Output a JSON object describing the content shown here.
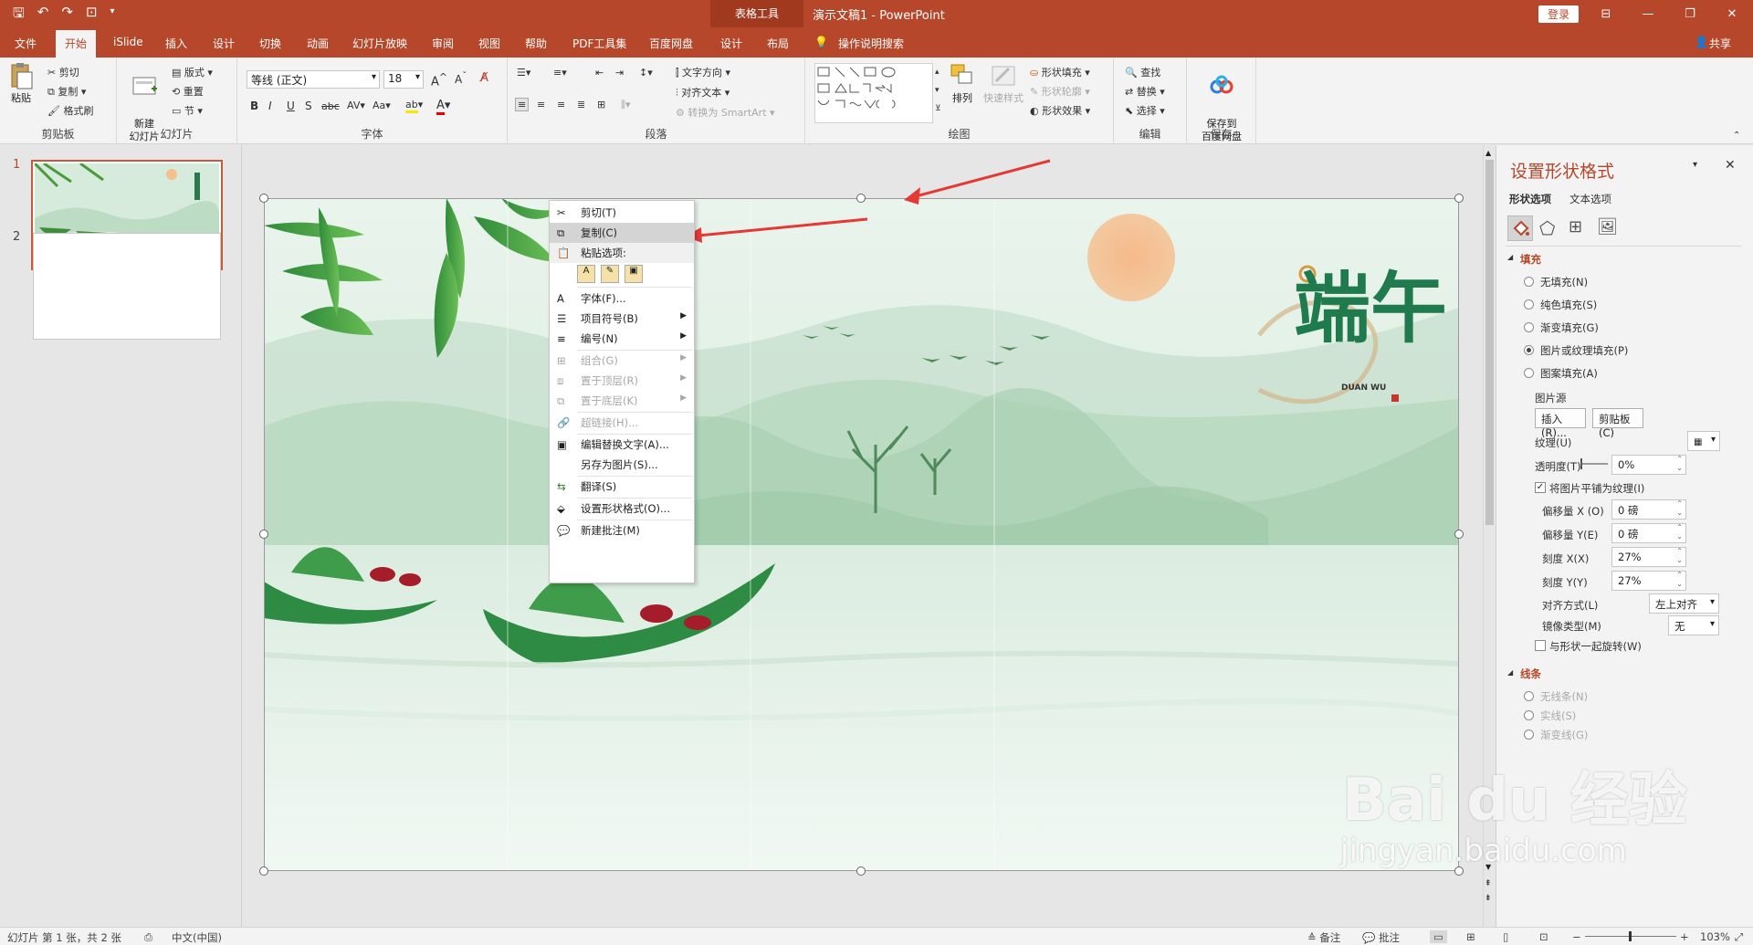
{
  "titlebar": {
    "contextual_label": "表格工具",
    "doc_title": "演示文稿1  -  PowerPoint",
    "login": "登录",
    "share": "共享"
  },
  "tabs": [
    "文件",
    "开始",
    "iSlide",
    "插入",
    "设计",
    "切换",
    "动画",
    "幻灯片放映",
    "审阅",
    "视图",
    "帮助",
    "PDF工具集",
    "百度网盘",
    "设计",
    "布局"
  ],
  "search_hint": "操作说明搜索",
  "ribbon": {
    "clipboard": {
      "paste": "粘贴",
      "cut": "剪切",
      "copy": "复制",
      "format_painter": "格式刷",
      "label": "剪贴板"
    },
    "slides": {
      "new_slide": "新建\n幻灯片",
      "layout": "版式",
      "reset": "重置",
      "section": "节",
      "label": "幻灯片"
    },
    "font": {
      "font_name": "等线 (正文)",
      "font_size": "18",
      "label": "字体"
    },
    "paragraph": {
      "text_direction": "文字方向",
      "align_text": "对齐文本",
      "smartart": "转换为 SmartArt",
      "label": "段落"
    },
    "drawing": {
      "arrange": "排列",
      "quick_styles": "快速样式",
      "shape_fill": "形状填充",
      "shape_outline": "形状轮廓",
      "shape_effects": "形状效果",
      "label": "绘图"
    },
    "editing": {
      "find": "查找",
      "replace": "替换",
      "select": "选择",
      "label": "编辑"
    },
    "save": {
      "save_to_cloud": "保存到\n百度网盘",
      "label": "保存"
    }
  },
  "slides_panel": [
    {
      "number": "1"
    },
    {
      "number": "2"
    }
  ],
  "slide_art": {
    "title_char": "端午",
    "subtitle": "DUAN WU"
  },
  "context_menu": [
    {
      "label": "剪切(T)",
      "disabled": false
    },
    {
      "label": "复制(C)",
      "disabled": false
    },
    {
      "label": "粘贴选项:",
      "disabled": false
    },
    {
      "label": "字体(F)...",
      "disabled": false
    },
    {
      "label": "项目符号(B)",
      "disabled": false
    },
    {
      "label": "编号(N)",
      "disabled": false
    },
    {
      "label": "组合(G)",
      "disabled": true
    },
    {
      "label": "置于顶层(R)",
      "disabled": true
    },
    {
      "label": "置于底层(K)",
      "disabled": true
    },
    {
      "label": "超链接(H)...",
      "disabled": true
    },
    {
      "label": "编辑替换文字(A)...",
      "disabled": false
    },
    {
      "label": "另存为图片(S)...",
      "disabled": false
    },
    {
      "label": "翻译(S)",
      "disabled": false
    },
    {
      "label": "设置形状格式(O)...",
      "disabled": false
    },
    {
      "label": "新建批注(M)",
      "disabled": false
    }
  ],
  "format_pane": {
    "title": "设置形状格式",
    "tab_shape": "形状选项",
    "tab_text": "文本选项",
    "fill_header": "填充",
    "fill_options": [
      "无填充(N)",
      "纯色填充(S)",
      "渐变填充(G)",
      "图片或纹理填充(P)",
      "图案填充(A)"
    ],
    "picture_source": "图片源",
    "insert_btn": "插入(R)...",
    "clipboard_btn": "剪贴板(C)",
    "texture": "纹理(U)",
    "transparency": "透明度(T)",
    "transparency_value": "0%",
    "tile_checkbox": "将图片平铺为纹理(I)",
    "offset_x": "偏移量 X (O)",
    "offset_x_value": "0 磅",
    "offset_y": "偏移量 Y(E)",
    "offset_y_value": "0 磅",
    "scale_x": "刻度 X(X)",
    "scale_x_value": "27%",
    "scale_y": "刻度 Y(Y)",
    "scale_y_value": "27%",
    "alignment": "对齐方式(L)",
    "alignment_value": "左上对齐",
    "mirror": "镜像类型(M)",
    "mirror_value": "无",
    "rotate_with_shape": "与形状一起旋转(W)",
    "line_header": "线条",
    "line_options": [
      "无线条(N)",
      "实线(S)",
      "渐变线(G)"
    ]
  },
  "status": {
    "slide_info": "幻灯片 第 1 张，共 2 张",
    "language": "中文(中国)",
    "notes": "备注",
    "comments": "批注",
    "zoom": "103%"
  },
  "watermark": {
    "brand": "Bai du 经验",
    "url": "jingyan.baidu.com"
  },
  "colors": {
    "accent": "#b7472a",
    "arrow": "#e53935"
  }
}
